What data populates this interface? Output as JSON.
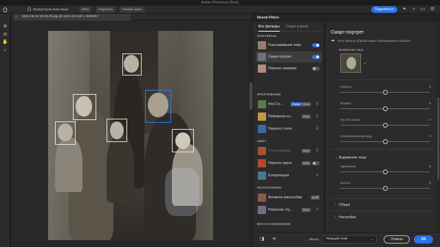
{
  "app": {
    "title": "Adobe Photoshop (Beta)",
    "share_label": "Поделиться"
  },
  "options_bar": {
    "scroll_all_label": "Прокрутка во всех окнах",
    "zoom_100": "100%",
    "fit_label": "Подогнать",
    "fullscreen_label": "Полный экран"
  },
  "document": {
    "tab_title": "2021-05-14 23.59.46.jpg @ 115% (Слой 2, RGB/8) *"
  },
  "neural_filters": {
    "panel_title": "Neural Filters",
    "tabs": [
      "Все фильтры",
      "Скоро в меню"
    ],
    "categories": {
      "portraits": "ПОРТРЕТЫ",
      "creative": "КРЕАТИВНЫЕ",
      "color": "ЦВЕТ",
      "photography": "ФОТОГРАФИЯ",
      "restoration": "ВОССТАНОВЛЕНИЕ"
    },
    "filters": [
      {
        "name": "Разглаживание кожи",
        "state": "on"
      },
      {
        "name": "Смарт-портрет",
        "state": "on"
      },
      {
        "name": "Перенос макияжа",
        "state": "off"
      },
      {
        "name": "Фон Со...",
        "badges": [
          "Новое",
          "Бета"
        ],
        "state": "cloud"
      },
      {
        "name": "Пейзажная ко...",
        "badges": [
          "Бета"
        ],
        "state": "cloud"
      },
      {
        "name": "Перенос стиля",
        "state": "cloud"
      },
      {
        "name": "Согласование",
        "badges": [
          "Бета"
        ],
        "state": "cloud"
      },
      {
        "name": "Перенос цвета",
        "badges": [
          "Бета"
        ],
        "state": "off"
      },
      {
        "name": "Колоризация",
        "state": "cloud"
      },
      {
        "name": "Активное масштабир.",
        "badges": [
          "Бета"
        ],
        "state": "cloud"
      },
      {
        "name": "Размытие глу...",
        "badges": [
          "Бета"
        ],
        "state": "cloud"
      }
    ]
  },
  "smart_portrait": {
    "title": "Смарт-портрет",
    "description": "Этот фильтр обрабатывает изображения в облаке.",
    "selected_face_label": "Выбранное лицо",
    "sliders": [
      {
        "label": "Радость",
        "value": "0",
        "fraction": 0.5
      },
      {
        "label": "Возраст",
        "value": "0",
        "fraction": 0.5
      },
      {
        "label": "Густота волос",
        "value": "0",
        "fraction": 0.5
      },
      {
        "label": "Направление взгляда",
        "value": "0",
        "fraction": 0.5
      }
    ],
    "section_face_expression": "Выражение лица",
    "expression_sliders": [
      {
        "label": "Удивление",
        "value": "0",
        "fraction": 0.5
      },
      {
        "label": "Злость",
        "value": "0",
        "fraction": 0.5
      }
    ],
    "section_general": "Общее",
    "section_settings": "Настройки"
  },
  "bottom": {
    "output_label": "Вывод",
    "output_value": "Текущий слой",
    "cancel_label": "Отмена",
    "ok_label": "ОК"
  },
  "status": {
    "text": "..."
  },
  "colors": {
    "accent": "#2c71e6",
    "panel_bg": "#2b2b2b",
    "face_box": "#e8e8e8",
    "face_box_selected": "#2e7bf2"
  }
}
